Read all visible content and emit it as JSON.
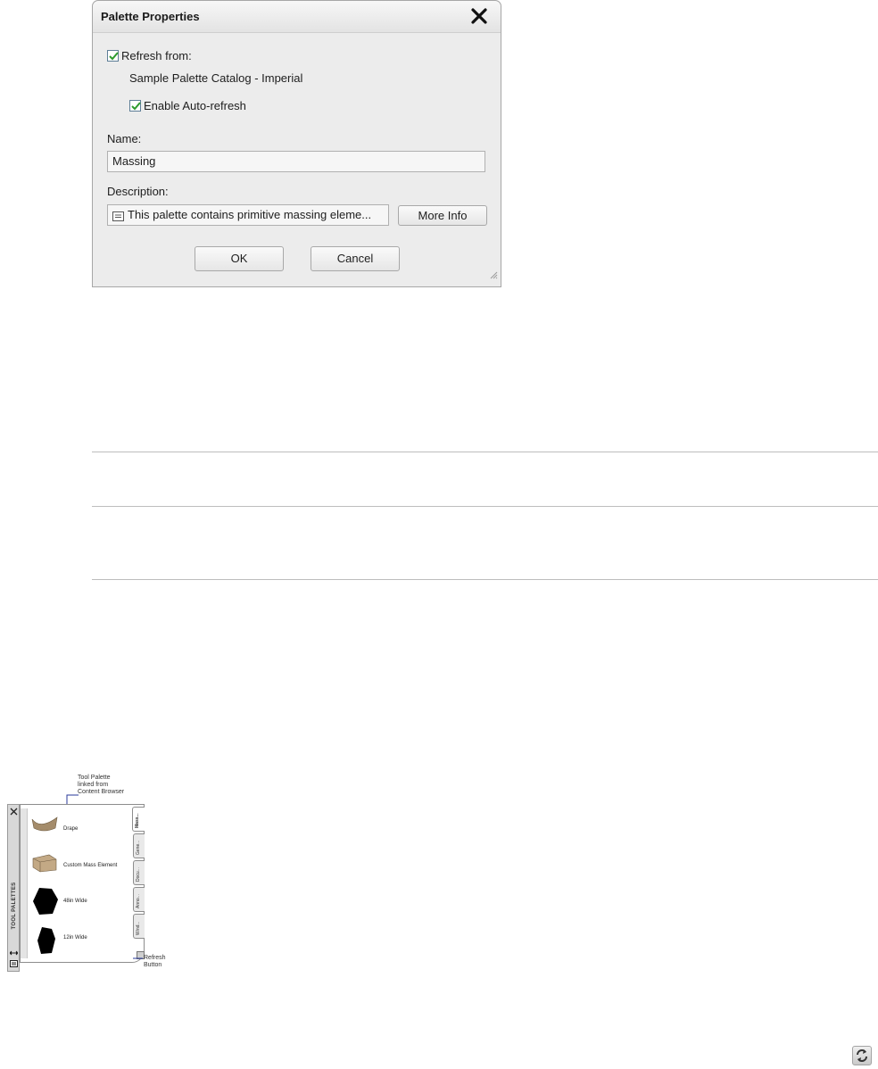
{
  "dialog": {
    "title": "Palette Properties",
    "refresh_from_label": "Refresh from:",
    "refresh_from_checked": true,
    "catalog_name": "Sample Palette Catalog - Imperial",
    "auto_refresh_label": "Enable Auto-refresh",
    "auto_refresh_checked": true,
    "name_label": "Name:",
    "name_value": "Massing",
    "description_label": "Description:",
    "description_value": "This palette contains primitive massing eleme...",
    "more_info_label": "More Info",
    "ok_label": "OK",
    "cancel_label": "Cancel",
    "check_color": "#2e9b2e"
  },
  "palette_figure": {
    "callout_top_line1": "Tool Palette",
    "callout_top_line2": "linked from",
    "callout_top_line3": "Content Browser",
    "callout_refresh_line1": "Refresh",
    "callout_refresh_line2": "Button",
    "strip_label": "TOOL PALETTES",
    "tools": [
      {
        "label": "Drape",
        "icon": "drape-shape-icon"
      },
      {
        "label": "Custom Mass Element",
        "icon": "custom-mass-element-icon"
      },
      {
        "label": "48in Wide",
        "icon": "black-hexagon-prism-icon"
      },
      {
        "label": "12in Wide",
        "icon": "black-hexagon-prism-icon"
      }
    ],
    "tabs": [
      "Mass...",
      "Gene...",
      "Docu...",
      "Anno...",
      "Wind..."
    ],
    "active_tab": "Mass..."
  },
  "refresh_icon": "refresh-icon"
}
